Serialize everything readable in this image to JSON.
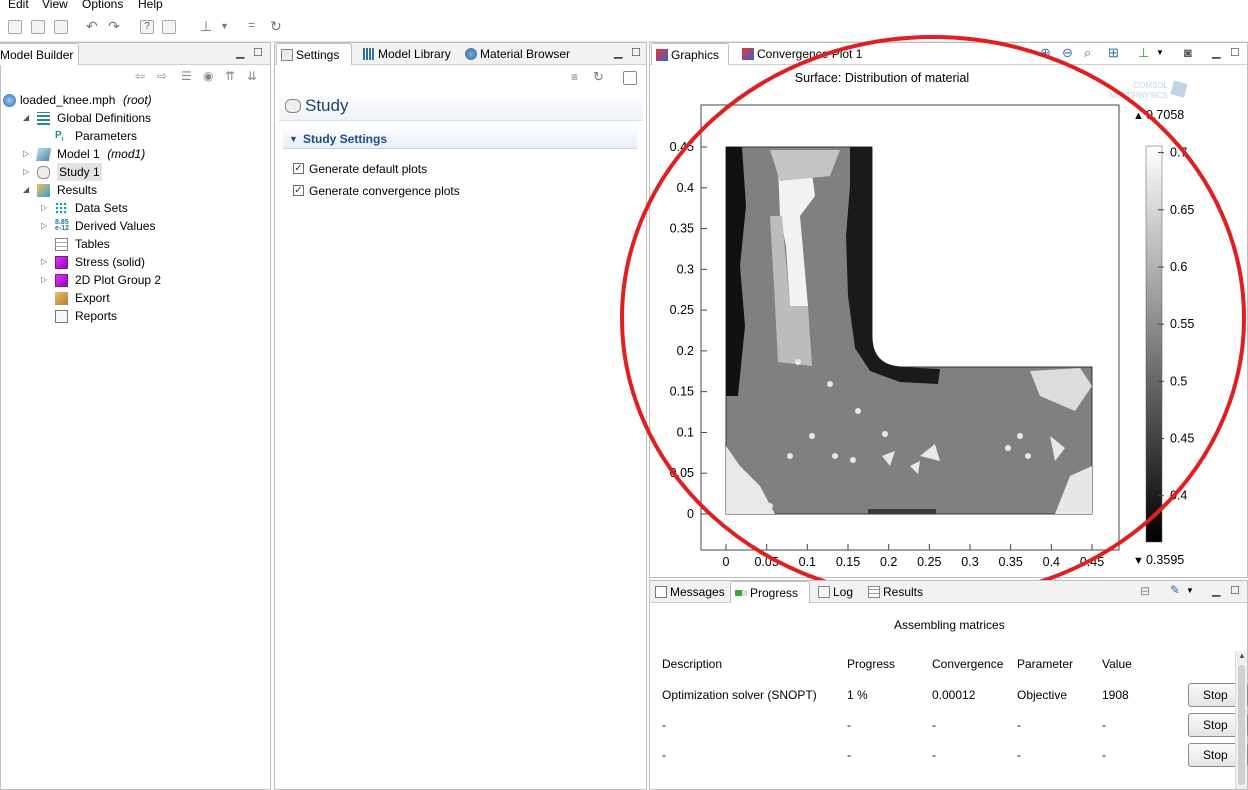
{
  "menu": [
    "Edit",
    "View",
    "Options",
    "Help"
  ],
  "model_builder": {
    "tab_label": "Model Builder",
    "tree": [
      {
        "label": "loaded_knee.mph",
        "suffix": "(root)",
        "level": 0,
        "icon": "file-icon",
        "toggle": ""
      },
      {
        "label": "Global Definitions",
        "suffix": "",
        "level": 1,
        "icon": "global-definitions-icon",
        "toggle": "expanded"
      },
      {
        "label": "Parameters",
        "suffix": "",
        "level": 2,
        "icon": "parameters-icon",
        "toggle": ""
      },
      {
        "label": "Model 1",
        "suffix": "(mod1)",
        "level": 1,
        "icon": "model-icon",
        "toggle": "collapsed"
      },
      {
        "label": "Study 1",
        "suffix": "",
        "level": 1,
        "icon": "study-icon",
        "toggle": "collapsed",
        "selected": true
      },
      {
        "label": "Results",
        "suffix": "",
        "level": 1,
        "icon": "results-icon",
        "toggle": "expanded"
      },
      {
        "label": "Data Sets",
        "suffix": "",
        "level": 2,
        "icon": "data-sets-icon",
        "toggle": "collapsed"
      },
      {
        "label": "Derived Values",
        "suffix": "",
        "level": 2,
        "icon": "derived-values-icon",
        "toggle": "collapsed"
      },
      {
        "label": "Tables",
        "suffix": "",
        "level": 2,
        "icon": "tables-icon",
        "toggle": ""
      },
      {
        "label": "Stress (solid)",
        "suffix": "",
        "level": 2,
        "icon": "plot-group-icon",
        "toggle": "collapsed"
      },
      {
        "label": "2D Plot Group 2",
        "suffix": "",
        "level": 2,
        "icon": "plot-group-icon",
        "toggle": "collapsed"
      },
      {
        "label": "Export",
        "suffix": "",
        "level": 2,
        "icon": "export-icon",
        "toggle": ""
      },
      {
        "label": "Reports",
        "suffix": "",
        "level": 2,
        "icon": "reports-icon",
        "toggle": ""
      }
    ],
    "derived_icon_text_top": "8.85",
    "derived_icon_text_bottom": "e-12",
    "parameters_icon_text": "P",
    "parameters_icon_sub": "i"
  },
  "settings": {
    "tabs": [
      "Settings",
      "Model Library",
      "Material Browser"
    ],
    "title": "Study",
    "section": "Study Settings",
    "checkboxes": [
      {
        "label": "Generate default plots",
        "checked": true
      },
      {
        "label": "Generate convergence plots",
        "checked": true
      }
    ]
  },
  "graphics": {
    "tabs": [
      "Graphics",
      "Convergence Plot 1"
    ],
    "plot_title": "Surface: Distribution of material",
    "logo_line1": "COMSOL",
    "logo_line2": "MULTIPHYSICS",
    "x_ticks": [
      "0",
      "0.05",
      "0.1",
      "0.15",
      "0.2",
      "0.25",
      "0.3",
      "0.35",
      "0.4",
      "0.45"
    ],
    "y_ticks": [
      "0",
      "0.05",
      "0.1",
      "0.15",
      "0.2",
      "0.25",
      "0.3",
      "0.35",
      "0.4",
      "0.45"
    ],
    "colorbar_max": "0.7058",
    "colorbar_min": "0.3595",
    "colorbar_ticks": [
      "0.7",
      "0.65",
      "0.6",
      "0.55",
      "0.5",
      "0.45",
      "0.4"
    ],
    "annotation_color": "#e02020"
  },
  "progress_panel": {
    "tabs": [
      "Messages",
      "Progress",
      "Log",
      "Results"
    ],
    "status": "Assembling matrices",
    "columns": [
      "Description",
      "Progress",
      "Convergence",
      "Parameter",
      "Value"
    ],
    "rows": [
      {
        "description": "Optimization solver (SNOPT)",
        "progress": "1 %",
        "convergence": "0.00012",
        "parameter": "Objective",
        "value": "1908",
        "button": "Stop"
      },
      {
        "description": "-",
        "progress": "-",
        "convergence": "-",
        "parameter": "-",
        "value": "-",
        "button": "Stop"
      },
      {
        "description": "-",
        "progress": "-",
        "convergence": "-",
        "parameter": "-",
        "value": "-",
        "button": "Stop"
      }
    ]
  }
}
